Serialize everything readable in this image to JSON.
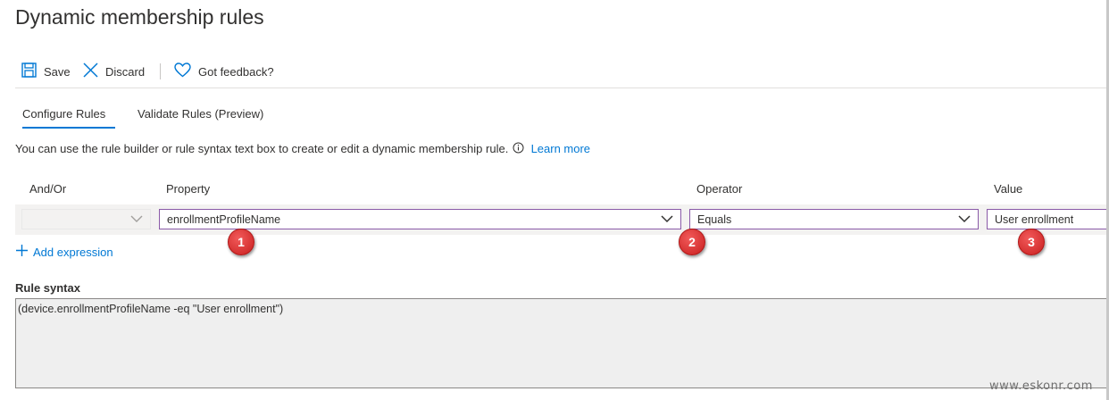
{
  "page": {
    "title": "Dynamic membership rules"
  },
  "toolbar": {
    "save_label": "Save",
    "discard_label": "Discard",
    "feedback_label": "Got feedback?"
  },
  "tabs": [
    {
      "label": "Configure Rules",
      "active": true
    },
    {
      "label": "Validate Rules (Preview)",
      "active": false
    }
  ],
  "description": {
    "text": "You can use the rule builder or rule syntax text box to create or edit a dynamic membership rule.",
    "learn_more": "Learn more"
  },
  "rule_table": {
    "headers": [
      "And/Or",
      "Property",
      "Operator",
      "Value"
    ],
    "row": {
      "and_or": "",
      "property": "enrollmentProfileName",
      "operator": "Equals",
      "value": "User enrollment"
    }
  },
  "add_expression_label": "Add expression",
  "annotations": [
    "1",
    "2",
    "3"
  ],
  "rule_syntax": {
    "label": "Rule syntax",
    "text": "(device.enrollmentProfileName -eq \"User enrollment\")"
  },
  "watermark": "www.eskonr.com",
  "colors": {
    "accent": "#0078d4",
    "dropdown_border": "#8a5aa8",
    "badge": "#d32f2f"
  }
}
